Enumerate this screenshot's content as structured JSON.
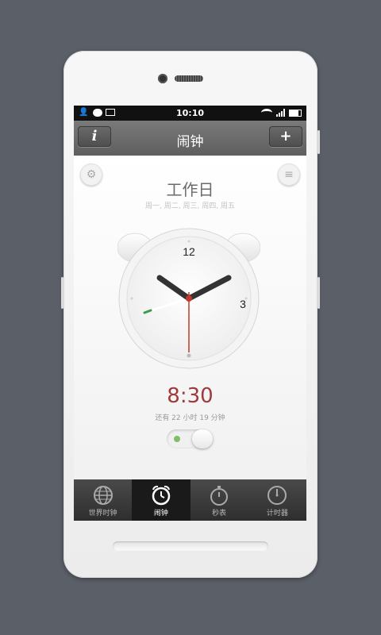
{
  "status_bar": {
    "time": "10:10",
    "left_icons": [
      "user-icon",
      "chat-icon",
      "mail-icon"
    ],
    "right_icons": [
      "wifi-icon",
      "signal-icon",
      "battery-icon"
    ]
  },
  "title_bar": {
    "title": "闹钟",
    "info_button": "i",
    "add_button": "+"
  },
  "alarm": {
    "name": "工作日",
    "days": "周一, 周二, 周三, 周四, 周五",
    "time": "8:30",
    "remaining": "还有 22 小时 19 分钟",
    "enabled": true
  },
  "clock": {
    "label_12": "12",
    "label_3": "3",
    "hour_hand_color": "#333333",
    "second_hand_color": "#c0392b",
    "alarm_hand_color": "#3c9a4a"
  },
  "tabs": [
    {
      "label": "世界时钟",
      "icon": "globe-icon",
      "active": false
    },
    {
      "label": "闹钟",
      "icon": "alarm-clock-icon",
      "active": true
    },
    {
      "label": "秒表",
      "icon": "stopwatch-icon",
      "active": false
    },
    {
      "label": "计时器",
      "icon": "timer-icon",
      "active": false
    }
  ],
  "colors": {
    "background": "#5b5f68",
    "accent_time": "#9e3a3a",
    "toggle_on": "#7fbf6a"
  }
}
